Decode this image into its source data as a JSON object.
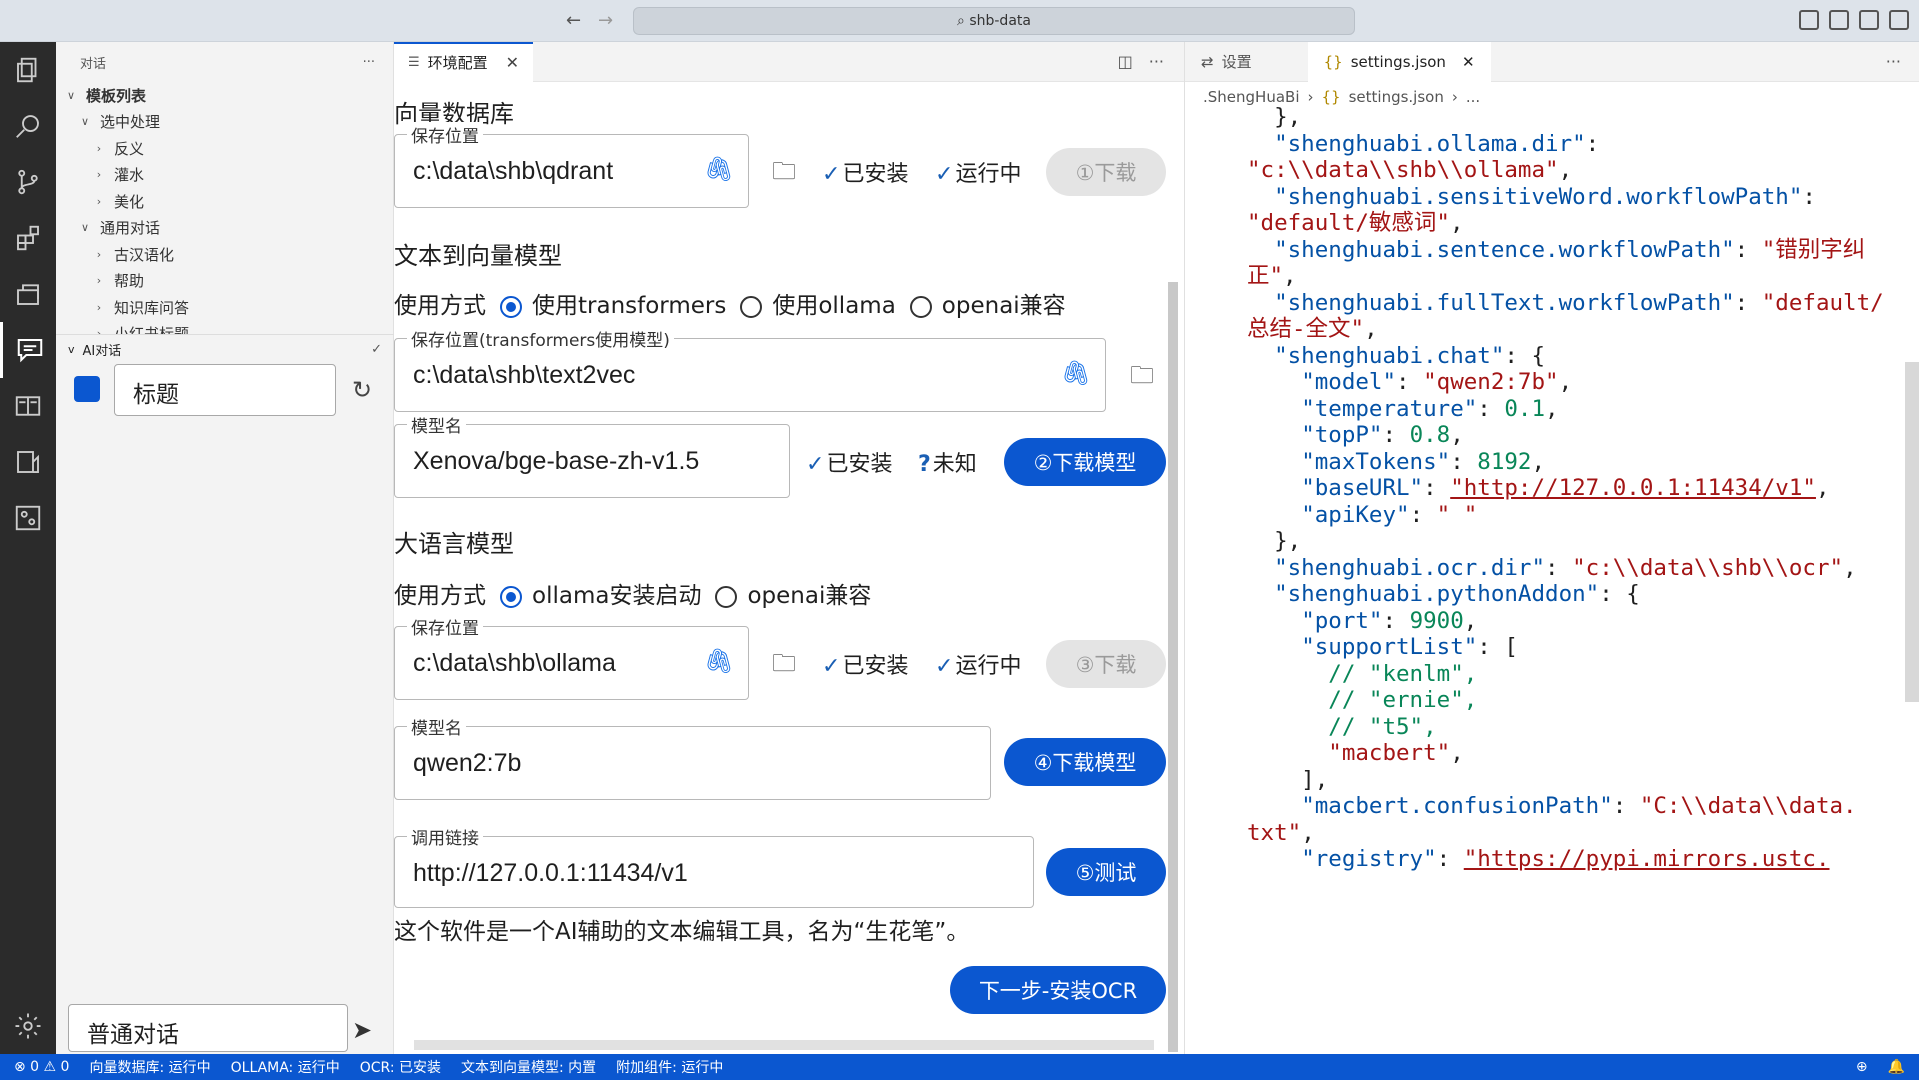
{
  "window": {
    "search": "shb-data"
  },
  "sidebar": {
    "title": "对话",
    "tree": [
      {
        "label": "模板列表",
        "level": 0,
        "chev": "v"
      },
      {
        "label": "选中处理",
        "level": 1,
        "chev": "v"
      },
      {
        "label": "反义",
        "level": 2,
        "chev": ">"
      },
      {
        "label": "灌水",
        "level": 2,
        "chev": ">"
      },
      {
        "label": "美化",
        "level": 2,
        "chev": ">"
      },
      {
        "label": "通用对话",
        "level": 1,
        "chev": "v"
      },
      {
        "label": "古汉语化",
        "level": 2,
        "chev": ">"
      },
      {
        "label": "帮助",
        "level": 2,
        "chev": ">"
      },
      {
        "label": "知识库问答",
        "level": 2,
        "chev": ">"
      },
      {
        "label": "小红书标题",
        "level": 2,
        "chev": ">"
      }
    ],
    "ai_section": "AI对话",
    "title_input": "标题",
    "chat_input": "普通对话"
  },
  "editor": {
    "tab": "环境配置",
    "vdb": {
      "heading": "向量数据库",
      "loc_label": "保存位置",
      "loc_value": "c:\\data\\shb\\qdrant",
      "installed": "已安装",
      "running": "运行中",
      "btn": "①下载"
    },
    "t2v": {
      "heading": "文本到向量模型",
      "mode_label": "使用方式",
      "opt1": "使用transformers",
      "opt2": "使用ollama",
      "opt3": "openai兼容",
      "loc_label": "保存位置(transformers使用模型)",
      "loc_value": "c:\\data\\shb\\text2vec",
      "model_label": "模型名",
      "model_value": "Xenova/bge-base-zh-v1.5",
      "installed": "已安装",
      "unknown": "未知",
      "btn": "②下载模型"
    },
    "llm": {
      "heading": "大语言模型",
      "mode_label": "使用方式",
      "opt1": "ollama安装启动",
      "opt2": "openai兼容",
      "loc_label": "保存位置",
      "loc_value": "c:\\data\\shb\\ollama",
      "installed": "已安装",
      "running": "运行中",
      "btn": "③下载",
      "model_label": "模型名",
      "model_value": "qwen2:7b",
      "model_btn": "④下载模型",
      "url_label": "调用链接",
      "url_value": "http://127.0.0.1:11434/v1",
      "test_btn": "⑤测试",
      "reply": "这个软件是一个AI辅助的文本编辑工具，名为“生花笔”。",
      "next_btn": "下一步-安装OCR"
    }
  },
  "right": {
    "tab1": "设置",
    "tab2": "settings.json",
    "crumb1": ".ShengHuaBi",
    "crumb2": "settings.json",
    "crumb3": "..."
  },
  "status": {
    "problems": "⊗ 0 ⚠ 0",
    "vdb": "向量数据库: 运行中",
    "ollama": "OLLAMA: 运行中",
    "ocr": "OCR: 已安装",
    "t2v": "文本到向量模型: 内置",
    "addon": "附加组件: 运行中"
  }
}
